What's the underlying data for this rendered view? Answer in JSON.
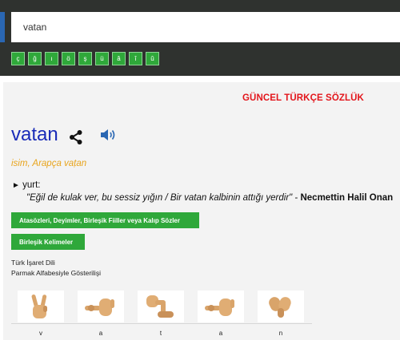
{
  "search": {
    "value": "vatan"
  },
  "keyboard": {
    "keys": [
      "ç",
      "ğ",
      "ı",
      "ö",
      "ş",
      "ü",
      "â",
      "î",
      "û"
    ]
  },
  "dictionary": {
    "title": "GÜNCEL TÜRKÇE SÖZLÜK"
  },
  "entry": {
    "word": "vatan",
    "meta": "isim, Arapça vaṭan",
    "definition_label": "yurt:",
    "example_quote": "\"Eğil de kulak ver, bu sessiz yığın / Bir vatan kalbinin attığı yerdir\"",
    "example_separator": " - ",
    "example_author": "Necmettin Halil Onan"
  },
  "buttons": {
    "idioms": "Atasözleri, Deyimler, Birleşik Fiiller veya Kalıp Sözler",
    "compounds": "Birleşik Kelimeler"
  },
  "sign_language": {
    "title": "Türk İşaret Dili",
    "subtitle": "Parmak Alfabesiyle Gösterilişi",
    "letters": [
      "v",
      "a",
      "t",
      "a",
      "n"
    ]
  },
  "colors": {
    "accent_blue": "#1a2cb8",
    "dictionary_red": "#e3151b",
    "button_green": "#2fa83a",
    "meta_orange": "#e8a41c"
  },
  "icons": {
    "share": "share-icon",
    "speaker": "speaker-icon"
  }
}
